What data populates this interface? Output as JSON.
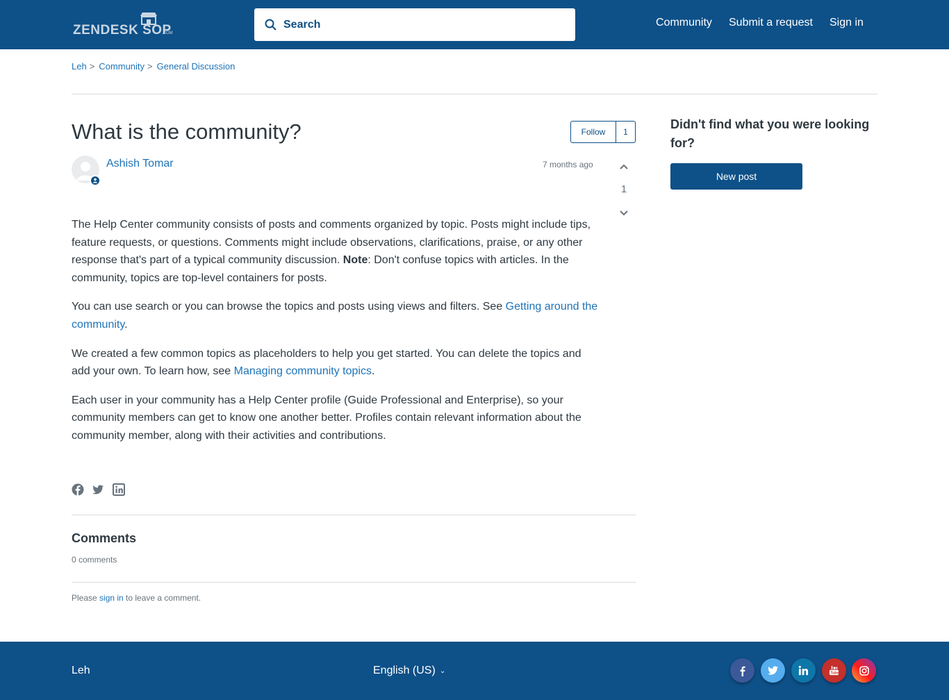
{
  "header": {
    "logo_text": "ZENDESK SHOP",
    "logo_word1": "ZENDESK S",
    "logo_word2": "OP",
    "logo_suffix": ".COM",
    "search_placeholder": "Search",
    "nav": [
      "Community",
      "Submit a request",
      "Sign in"
    ]
  },
  "breadcrumb": [
    "Leh",
    "Community",
    "General Discussion"
  ],
  "post": {
    "title": "What is the community?",
    "follow_label": "Follow",
    "follow_count": "1",
    "author": "Ashish Tomar",
    "time": "7 months ago",
    "vote_count": "1",
    "p1_a": "The Help Center community consists of posts and comments organized by topic. Posts might include tips, feature requests, or questions. Comments might include observations, clarifications, praise, or any other response that's part of a typical community discussion. ",
    "p1_note": "Note",
    "p1_b": ": Don't confuse topics with articles. In the community, topics are top-level containers for posts.",
    "p2_a": "You can use search or you can browse the topics and posts using views and filters. See ",
    "p2_link": "Getting around the community",
    "p2_b": ".",
    "p3_a": "We created a few common topics as placeholders to help you get started. You can delete the topics and add your own. To learn how, see ",
    "p3_link": "Managing community topics",
    "p3_b": ".",
    "p4": "Each user in your community has a Help Center profile (Guide Professional and Enterprise), so your community members can get to know one another better. Profiles contain relevant information about the community member, along with their activities and contributions."
  },
  "share_icons": [
    "facebook-icon",
    "twitter-icon",
    "linkedin-icon"
  ],
  "comments": {
    "title": "Comments",
    "count": "0 comments",
    "note_a": "Please ",
    "note_link": "sign in",
    "note_b": " to leave a comment."
  },
  "sidebar": {
    "title": "Didn't find what you were looking for?",
    "button": "New post"
  },
  "footer": {
    "brand": "Leh",
    "language": "English (US)",
    "social": [
      {
        "name": "facebook",
        "color": "#3b5998"
      },
      {
        "name": "twitter",
        "color": "#55acee"
      },
      {
        "name": "linkedin",
        "color": "#0e76a8"
      },
      {
        "name": "youtube",
        "color": "#c4302b"
      },
      {
        "name": "instagram",
        "color": "#d6249f"
      }
    ]
  },
  "colors": {
    "brand": "#0e5088",
    "link": "#1f73b7",
    "text": "#2f3941",
    "muted": "#68737d"
  }
}
